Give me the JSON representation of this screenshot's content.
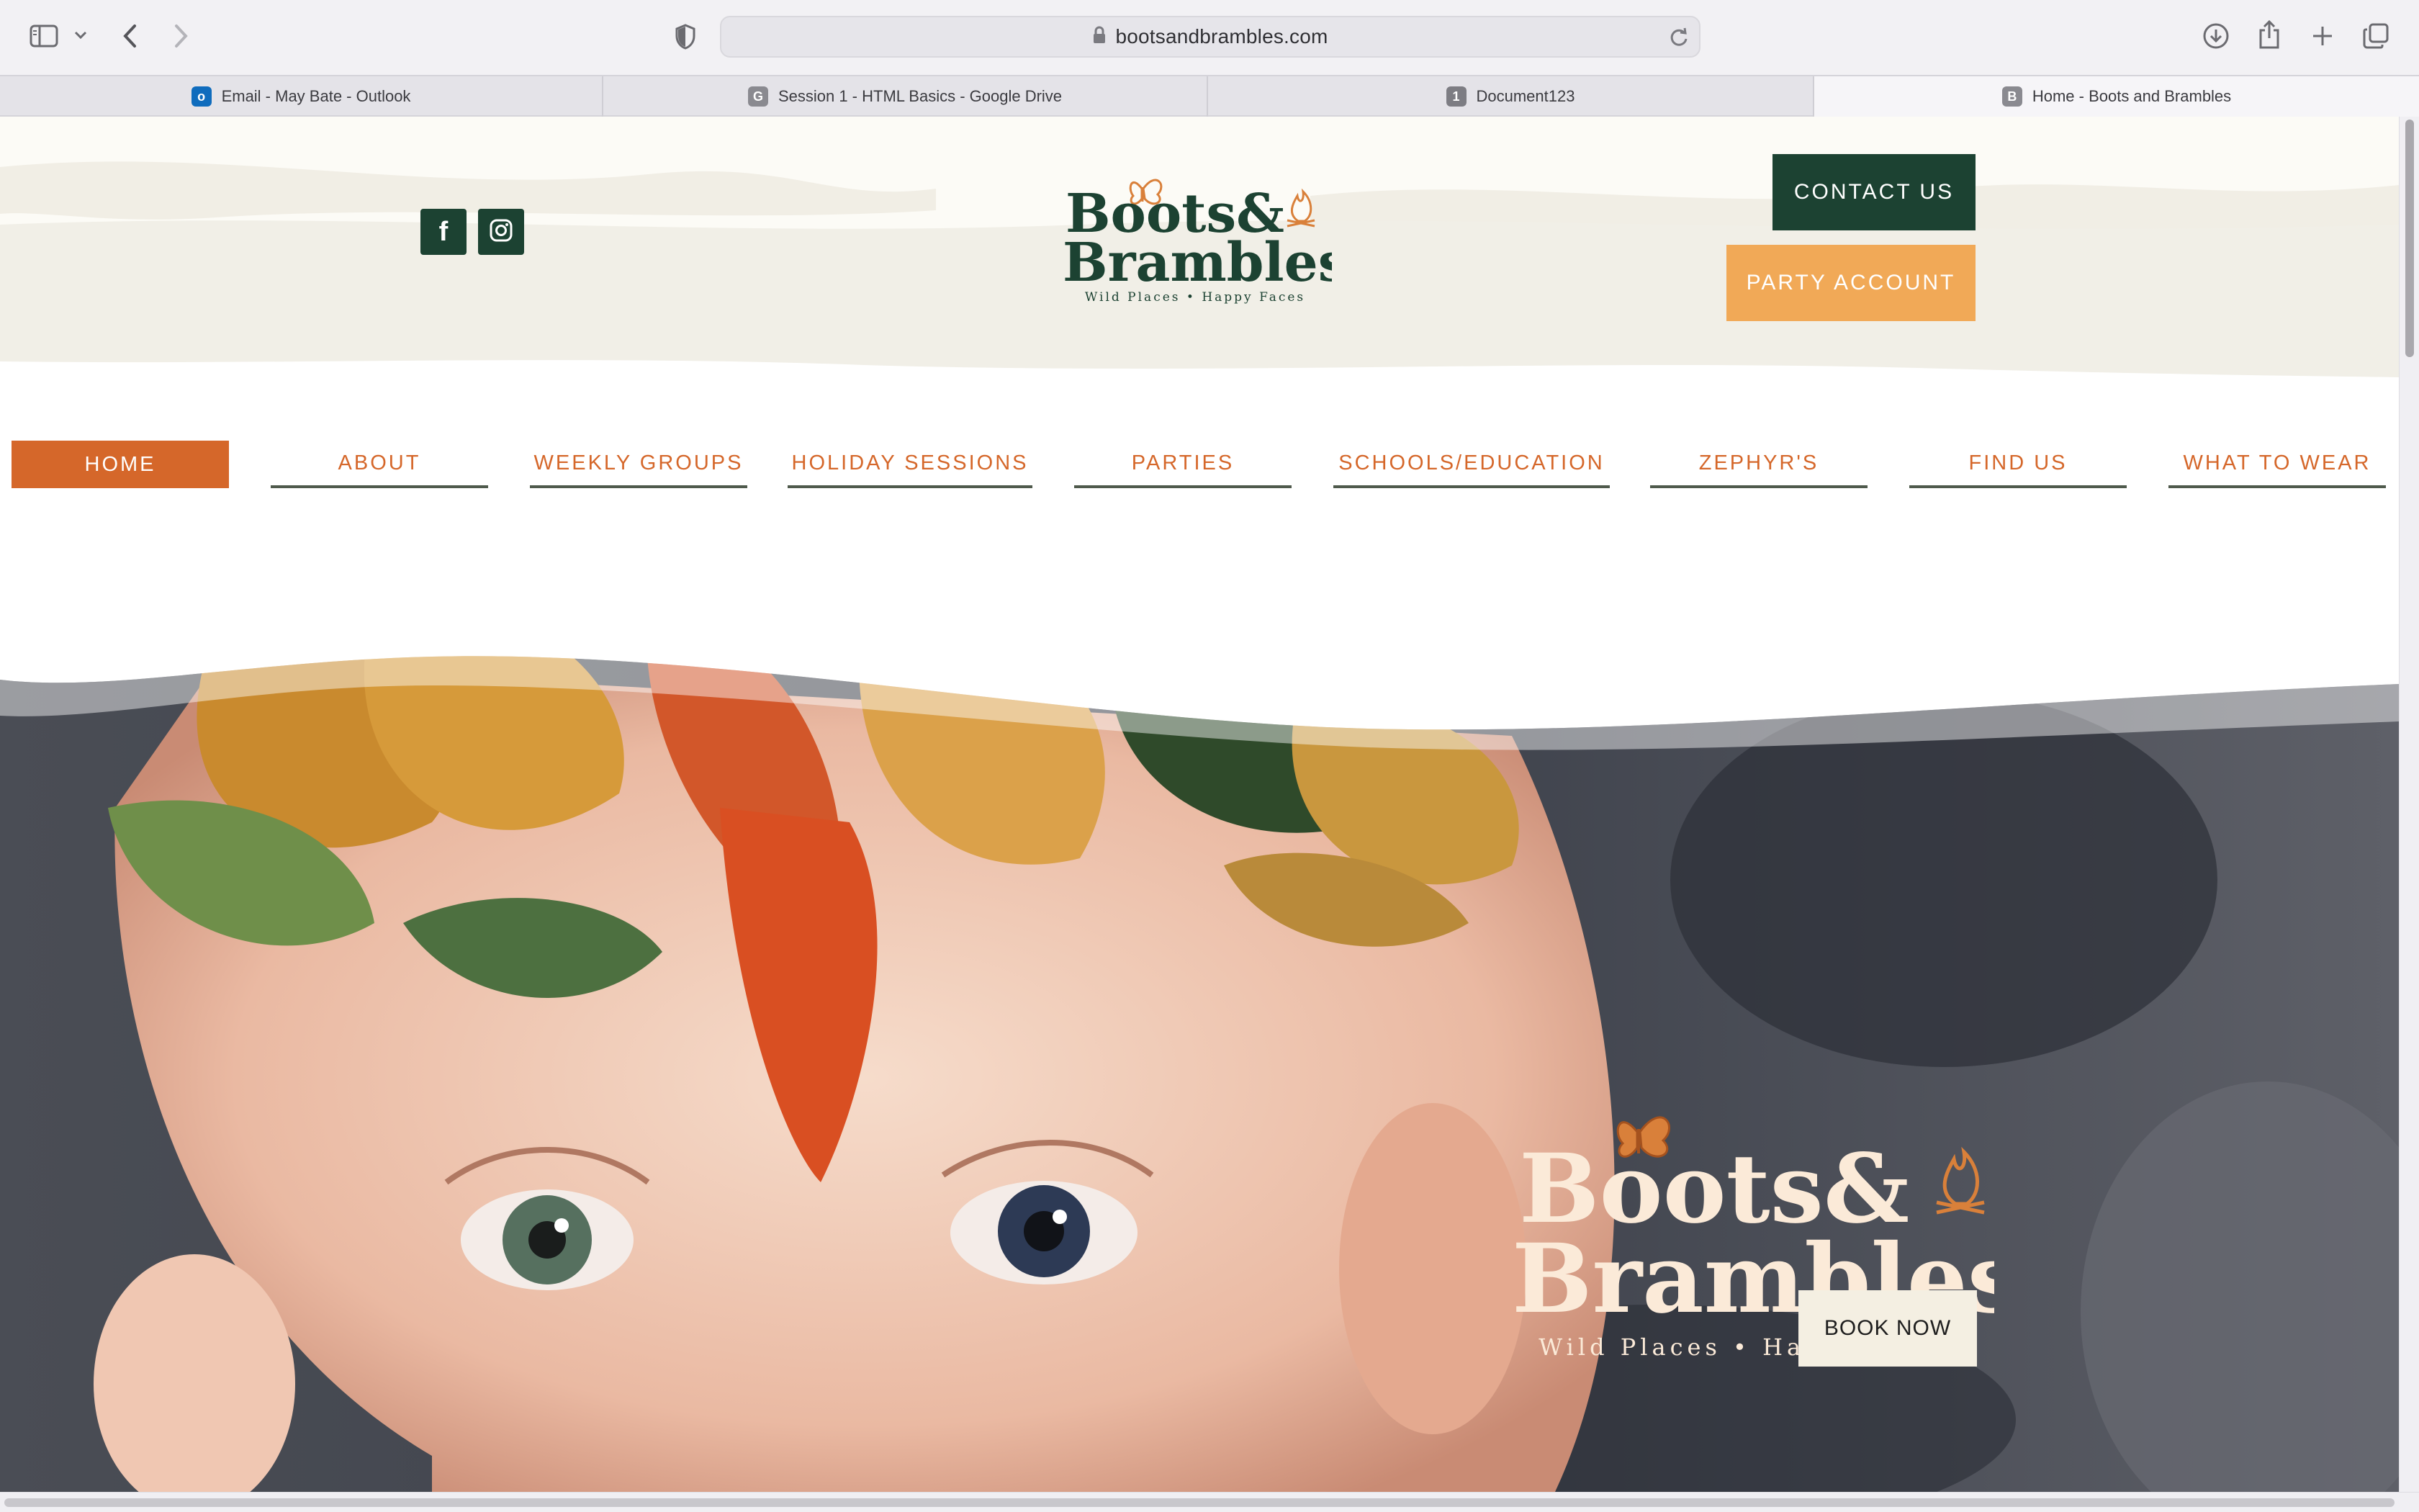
{
  "browser": {
    "url": "bootsandbrambles.com",
    "tabs": [
      {
        "label": "Email - May Bate - Outlook",
        "favicon": "outlook-icon",
        "active": false
      },
      {
        "label": "Session 1 - HTML Basics - Google Drive",
        "favicon": "G",
        "active": false
      },
      {
        "label": "Document123",
        "favicon": "1",
        "active": false
      },
      {
        "label": "Home - Boots and Brambles",
        "favicon": "B",
        "active": true
      }
    ],
    "icons": [
      "sidebar-icon",
      "chevron-down-icon",
      "back-icon",
      "forward-icon",
      "privacy-shield-icon",
      "lock-icon",
      "reload-icon",
      "download-icon",
      "share-icon",
      "new-tab-icon",
      "tab-overview-icon"
    ]
  },
  "header": {
    "social": [
      {
        "name": "facebook-icon",
        "glyph": "f"
      },
      {
        "name": "instagram-icon"
      }
    ],
    "logo": {
      "line1": "Boots&",
      "line2": "Brambles",
      "tagline": "Wild Places • Happy Faces"
    },
    "contact_label": "CONTACT US",
    "party_label": "PARTY ACCOUNT"
  },
  "nav": {
    "items": [
      "HOME",
      "ABOUT",
      "WEEKLY GROUPS",
      "HOLIDAY SESSIONS",
      "PARTIES",
      "SCHOOLS/EDUCATION",
      "ZEPHYR'S",
      "FIND US",
      "WHAT TO WEAR"
    ],
    "active": "HOME"
  },
  "hero": {
    "logo": {
      "line1": "Boots&",
      "line2": "Brambles",
      "tagline": "Wild Places • Happy Faces"
    },
    "book_label": "BOOK NOW"
  },
  "colors": {
    "brand_green": "#1c4232",
    "brand_orange": "#d5672a",
    "party_orange": "#f1a957",
    "cream": "#f4efe2"
  }
}
